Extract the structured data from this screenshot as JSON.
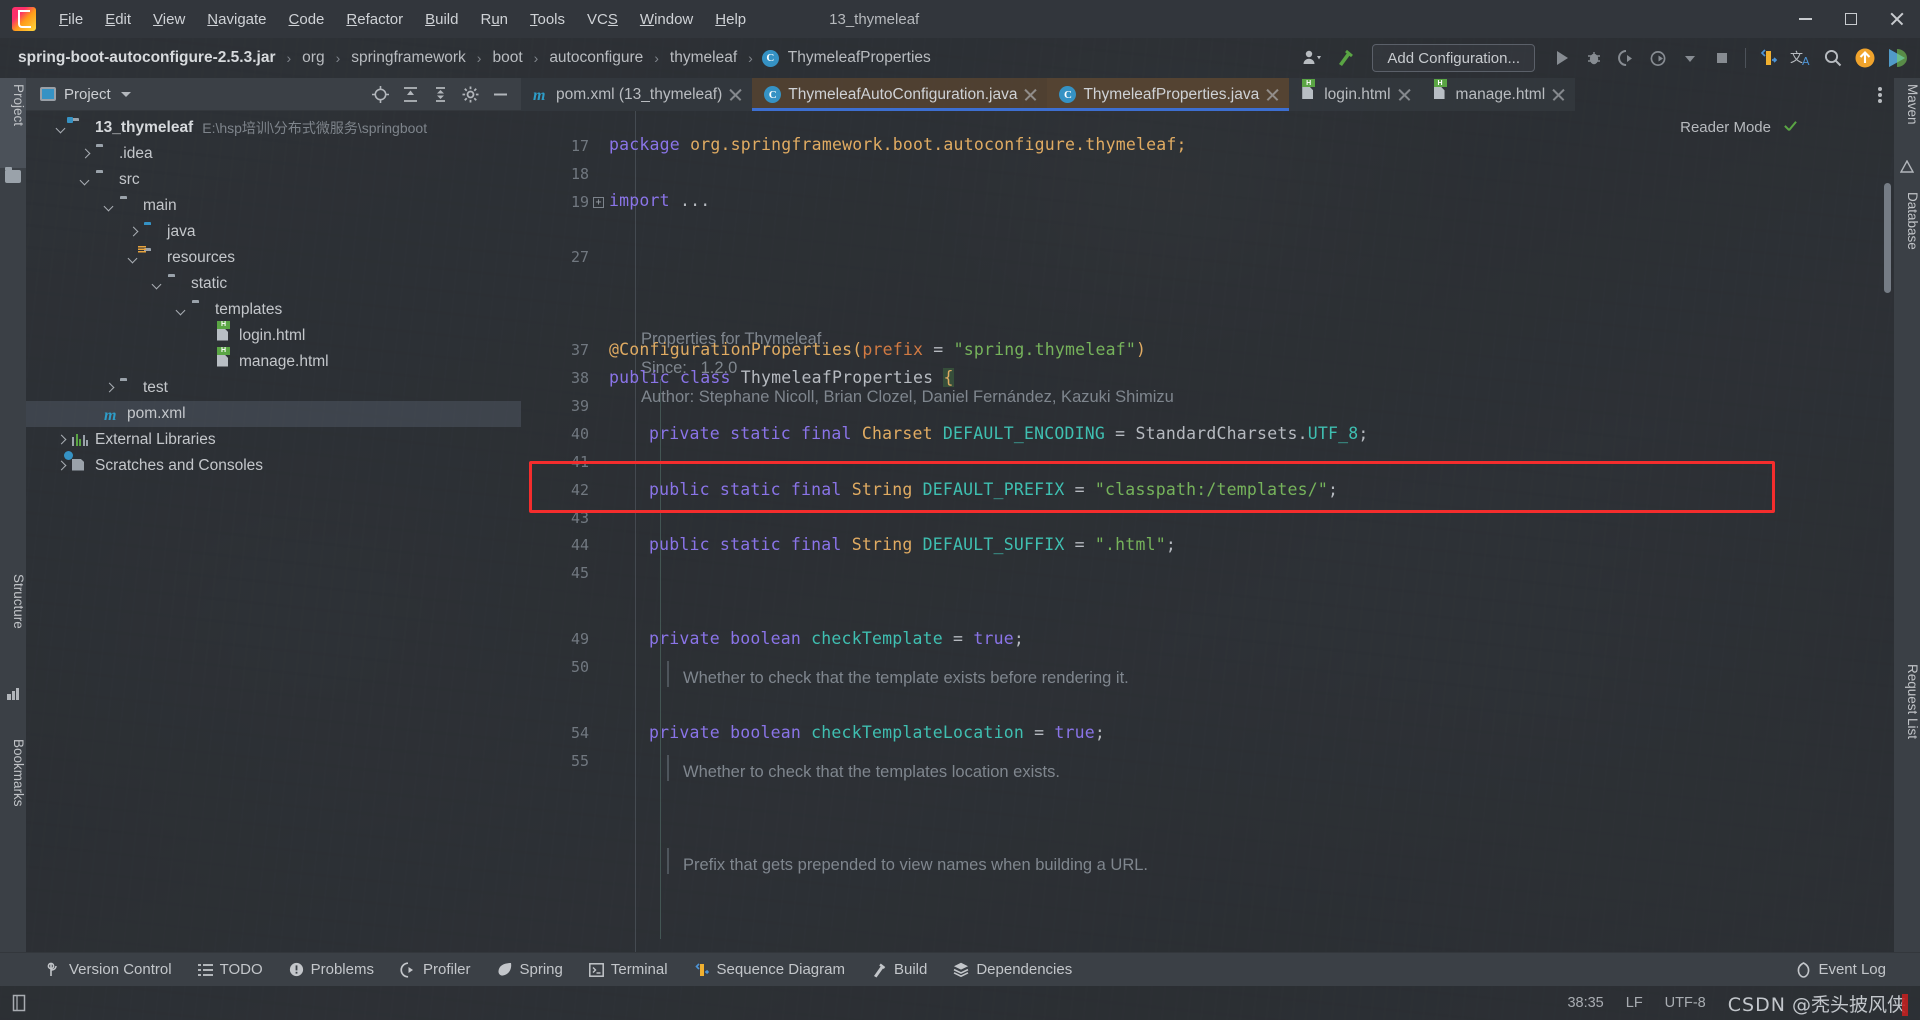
{
  "window": {
    "title": "13_thymeleaf",
    "minimize_label": "Minimize",
    "maximize_label": "Maximize",
    "close_label": "Close"
  },
  "menubar": {
    "items": [
      {
        "label": "File"
      },
      {
        "label": "Edit"
      },
      {
        "label": "View"
      },
      {
        "label": "Navigate"
      },
      {
        "label": "Code"
      },
      {
        "label": "Refactor"
      },
      {
        "label": "Build"
      },
      {
        "label": "Run"
      },
      {
        "label": "Tools"
      },
      {
        "label": "VCS"
      },
      {
        "label": "Window"
      },
      {
        "label": "Help"
      }
    ]
  },
  "navbar": {
    "breadcrumbs": [
      {
        "label": "spring-boot-autoconfigure-2.5.3.jar",
        "type": "jar"
      },
      {
        "label": "org",
        "type": "package"
      },
      {
        "label": "springframework",
        "type": "package"
      },
      {
        "label": "boot",
        "type": "package"
      },
      {
        "label": "autoconfigure",
        "type": "package"
      },
      {
        "label": "thymeleaf",
        "type": "package"
      },
      {
        "label": "ThymeleafProperties",
        "type": "class",
        "badge": "C"
      }
    ],
    "separator": "›",
    "add_configuration": "Add Configuration...",
    "icons": {
      "profile": "user-dropdown-icon",
      "build": "build-hammer-icon",
      "run": "run-icon",
      "debug": "debug-icon",
      "run_coverage": "run-with-coverage-icon",
      "profile_run": "profiler-icon",
      "stop": "stop-icon",
      "sequence": "sequence-diagram-icon",
      "translate": "translate-icon",
      "search": "search-everywhere-icon",
      "update": "update-project-icon",
      "ide_feature": "ide-feature-icon"
    }
  },
  "left_rail": {
    "items": [
      {
        "label": "Project",
        "selected": true
      },
      {
        "label": "Structure",
        "selected": false
      },
      {
        "label": "Bookmarks",
        "selected": false
      }
    ]
  },
  "right_rail": {
    "items": [
      {
        "label": "Maven"
      },
      {
        "label": "Database"
      },
      {
        "label": "Request List"
      }
    ]
  },
  "project_panel": {
    "title": "Project",
    "actions": [
      "locate-icon",
      "expand-all-icon",
      "collapse-all-icon",
      "settings-gear-icon",
      "hide-icon"
    ],
    "tree": [
      {
        "label": "13_thymeleaf",
        "path": "E:\\hsp培训\\分布式微服务\\springboot",
        "indent": 0,
        "arrow": "down",
        "icon": "module-folder",
        "bold": true,
        "selected": false
      },
      {
        "label": ".idea",
        "path": "",
        "indent": 1,
        "arrow": "right",
        "icon": "folder",
        "bold": false,
        "selected": false
      },
      {
        "label": "src",
        "path": "",
        "indent": 1,
        "arrow": "down",
        "icon": "folder",
        "bold": false,
        "selected": false
      },
      {
        "label": "main",
        "path": "",
        "indent": 2,
        "arrow": "down",
        "icon": "folder",
        "bold": false,
        "selected": false
      },
      {
        "label": "java",
        "path": "",
        "indent": 3,
        "arrow": "right",
        "icon": "source-folder",
        "bold": false,
        "selected": false
      },
      {
        "label": "resources",
        "path": "",
        "indent": 3,
        "arrow": "down",
        "icon": "resource-folder",
        "bold": false,
        "selected": false
      },
      {
        "label": "static",
        "path": "",
        "indent": 4,
        "arrow": "down",
        "icon": "folder",
        "bold": false,
        "selected": false
      },
      {
        "label": "templates",
        "path": "",
        "indent": 5,
        "arrow": "down",
        "icon": "folder",
        "bold": false,
        "selected": false
      },
      {
        "label": "login.html",
        "path": "",
        "indent": 6,
        "arrow": "none",
        "icon": "html-file",
        "bold": false,
        "selected": false
      },
      {
        "label": "manage.html",
        "path": "",
        "indent": 6,
        "arrow": "none",
        "icon": "html-file",
        "bold": false,
        "selected": false
      },
      {
        "label": "test",
        "path": "",
        "indent": 2,
        "arrow": "right",
        "icon": "folder",
        "bold": false,
        "selected": false
      },
      {
        "label": "pom.xml",
        "path": "",
        "indent": 2,
        "arrow": "none",
        "icon": "maven-file",
        "bold": false,
        "selected": true
      },
      {
        "label": "External Libraries",
        "path": "",
        "indent": 0,
        "arrow": "right",
        "icon": "libraries",
        "bold": false,
        "selected": false
      },
      {
        "label": "Scratches and Consoles",
        "path": "",
        "indent": 0,
        "arrow": "right",
        "icon": "scratches",
        "bold": false,
        "selected": false
      }
    ]
  },
  "editor": {
    "tabs": [
      {
        "label": "pom.xml (13_thymeleaf)",
        "icon": "maven-file",
        "state": "inactive"
      },
      {
        "label": "ThymeleafAutoConfiguration.java",
        "icon": "class-file",
        "state": "inactive-java"
      },
      {
        "label": "ThymeleafProperties.java",
        "icon": "class-file",
        "state": "selected"
      },
      {
        "label": "login.html",
        "icon": "html-file",
        "state": "inactive"
      },
      {
        "label": "manage.html",
        "icon": "html-file",
        "state": "inactive"
      }
    ],
    "reader_mode": "Reader Mode",
    "gutter_lines": [
      "17",
      "18",
      "19",
      "27",
      "37",
      "38",
      "39",
      "40",
      "41",
      "42",
      "43",
      "44",
      "45",
      "49",
      "50",
      "54",
      "55"
    ],
    "javadoc": [
      "Properties for Thymeleaf.",
      "Since:   1.2.0",
      "Author: Stephane Nicoll, Brian Clozel, Daniel Fernández, Kazuki Shimizu"
    ],
    "inline_docs": [
      "Whether to check that the template exists before rendering it.",
      "Whether to check that the templates location exists.",
      "Prefix that gets prepended to view names when building a URL."
    ],
    "code": {
      "package_keyword": "package",
      "package_name": "org.springframework.boot.autoconfigure.thymeleaf;",
      "import_keyword": "import",
      "import_ellipsis": "...",
      "annotation": "@ConfigurationProperties(",
      "annotation_param": "prefix",
      "annotation_eq": " = ",
      "annotation_value": "\"spring.thymeleaf\"",
      "annotation_close": ")",
      "class_decl_mod": "public class ",
      "class_name": "ThymeleafProperties ",
      "class_brace": "{",
      "field1": {
        "mods": "private static final ",
        "type": "Charset ",
        "name": "DEFAULT_ENCODING",
        "eq": " = ",
        "value": "StandardCharsets.",
        "value2": "UTF_8",
        "end": ";"
      },
      "field2": {
        "mods": "public static final ",
        "type": "String ",
        "name": "DEFAULT_PREFIX",
        "eq": " = ",
        "value": "\"classpath:/templates/\"",
        "end": ";"
      },
      "field3": {
        "mods": "public static final ",
        "type": "String ",
        "name": "DEFAULT_SUFFIX",
        "eq": " = ",
        "value": "\".html\"",
        "end": ";"
      },
      "field4": {
        "mods": "private ",
        "type": "boolean ",
        "name": "checkTemplate",
        "eq": " = ",
        "value": "true",
        "end": ";"
      },
      "field5": {
        "mods": "private ",
        "type": "boolean ",
        "name": "checkTemplateLocation",
        "eq": " = ",
        "value": "true",
        "end": ";"
      }
    },
    "highlight_color": "#f42d2d"
  },
  "bottom_bar": {
    "items": [
      {
        "label": "Version Control",
        "icon": "vcs-branch-icon"
      },
      {
        "label": "TODO",
        "icon": "todo-list-icon"
      },
      {
        "label": "Problems",
        "icon": "problems-icon"
      },
      {
        "label": "Profiler",
        "icon": "profiler-icon"
      },
      {
        "label": "Spring",
        "icon": "spring-leaf-icon"
      },
      {
        "label": "Terminal",
        "icon": "terminal-icon"
      },
      {
        "label": "Sequence Diagram",
        "icon": "sequence-diagram-icon"
      },
      {
        "label": "Build",
        "icon": "build-hammer-icon"
      },
      {
        "label": "Dependencies",
        "icon": "dependencies-icon"
      }
    ],
    "event_log": {
      "label": "Event Log",
      "icon": "event-log-icon"
    }
  },
  "status_bar": {
    "caret_position": "38:35",
    "line_separator": "LF",
    "encoding": "UTF-8",
    "watermark_brand": "CSDN",
    "watermark_author": "@秃头披风侠",
    "left_icon": "layout-icon"
  },
  "colors": {
    "accent_blue": "#3d6fd1",
    "keyword_purple": "#8a74e8",
    "type_orange": "#e0ab62",
    "string_green": "#76b35b",
    "constant_teal": "#3fbfb1",
    "highlight_red": "#f42d2d",
    "tab_selected_bg": "#624a32"
  }
}
